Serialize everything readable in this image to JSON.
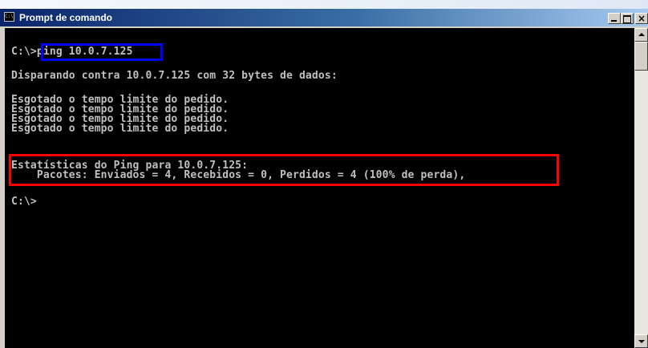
{
  "window": {
    "title": "Prompt de comando",
    "icon": "cmd-icon",
    "icon_glyph": "C:\\",
    "controls": {
      "minimize": "minimize-icon",
      "maximize": "maximize-icon",
      "close": "close-icon",
      "close_glyph": "×"
    }
  },
  "console": {
    "prompt_path": "C:\\>",
    "command": "ping 10.0.7.125",
    "lines": [
      "Disparando contra 10.0.7.125 com 32 bytes de dados:",
      "Esgotado o tempo limite do pedido.",
      "Esgotado o tempo limite do pedido.",
      "Esgotado o tempo limite do pedido.",
      "Esgotado o tempo limite do pedido.",
      "Estatísticas do Ping para 10.0.7.125:",
      "    Pacotes: Enviados = 4, Recebidos = 0, Perdidos = 4 (100% de perda),",
      "C:\\>"
    ],
    "text_color": "#c0c0c0",
    "background_color": "#000000"
  },
  "annotations": {
    "command_highlight_color": "#0000ff",
    "stats_highlight_color": "#ff0000"
  }
}
